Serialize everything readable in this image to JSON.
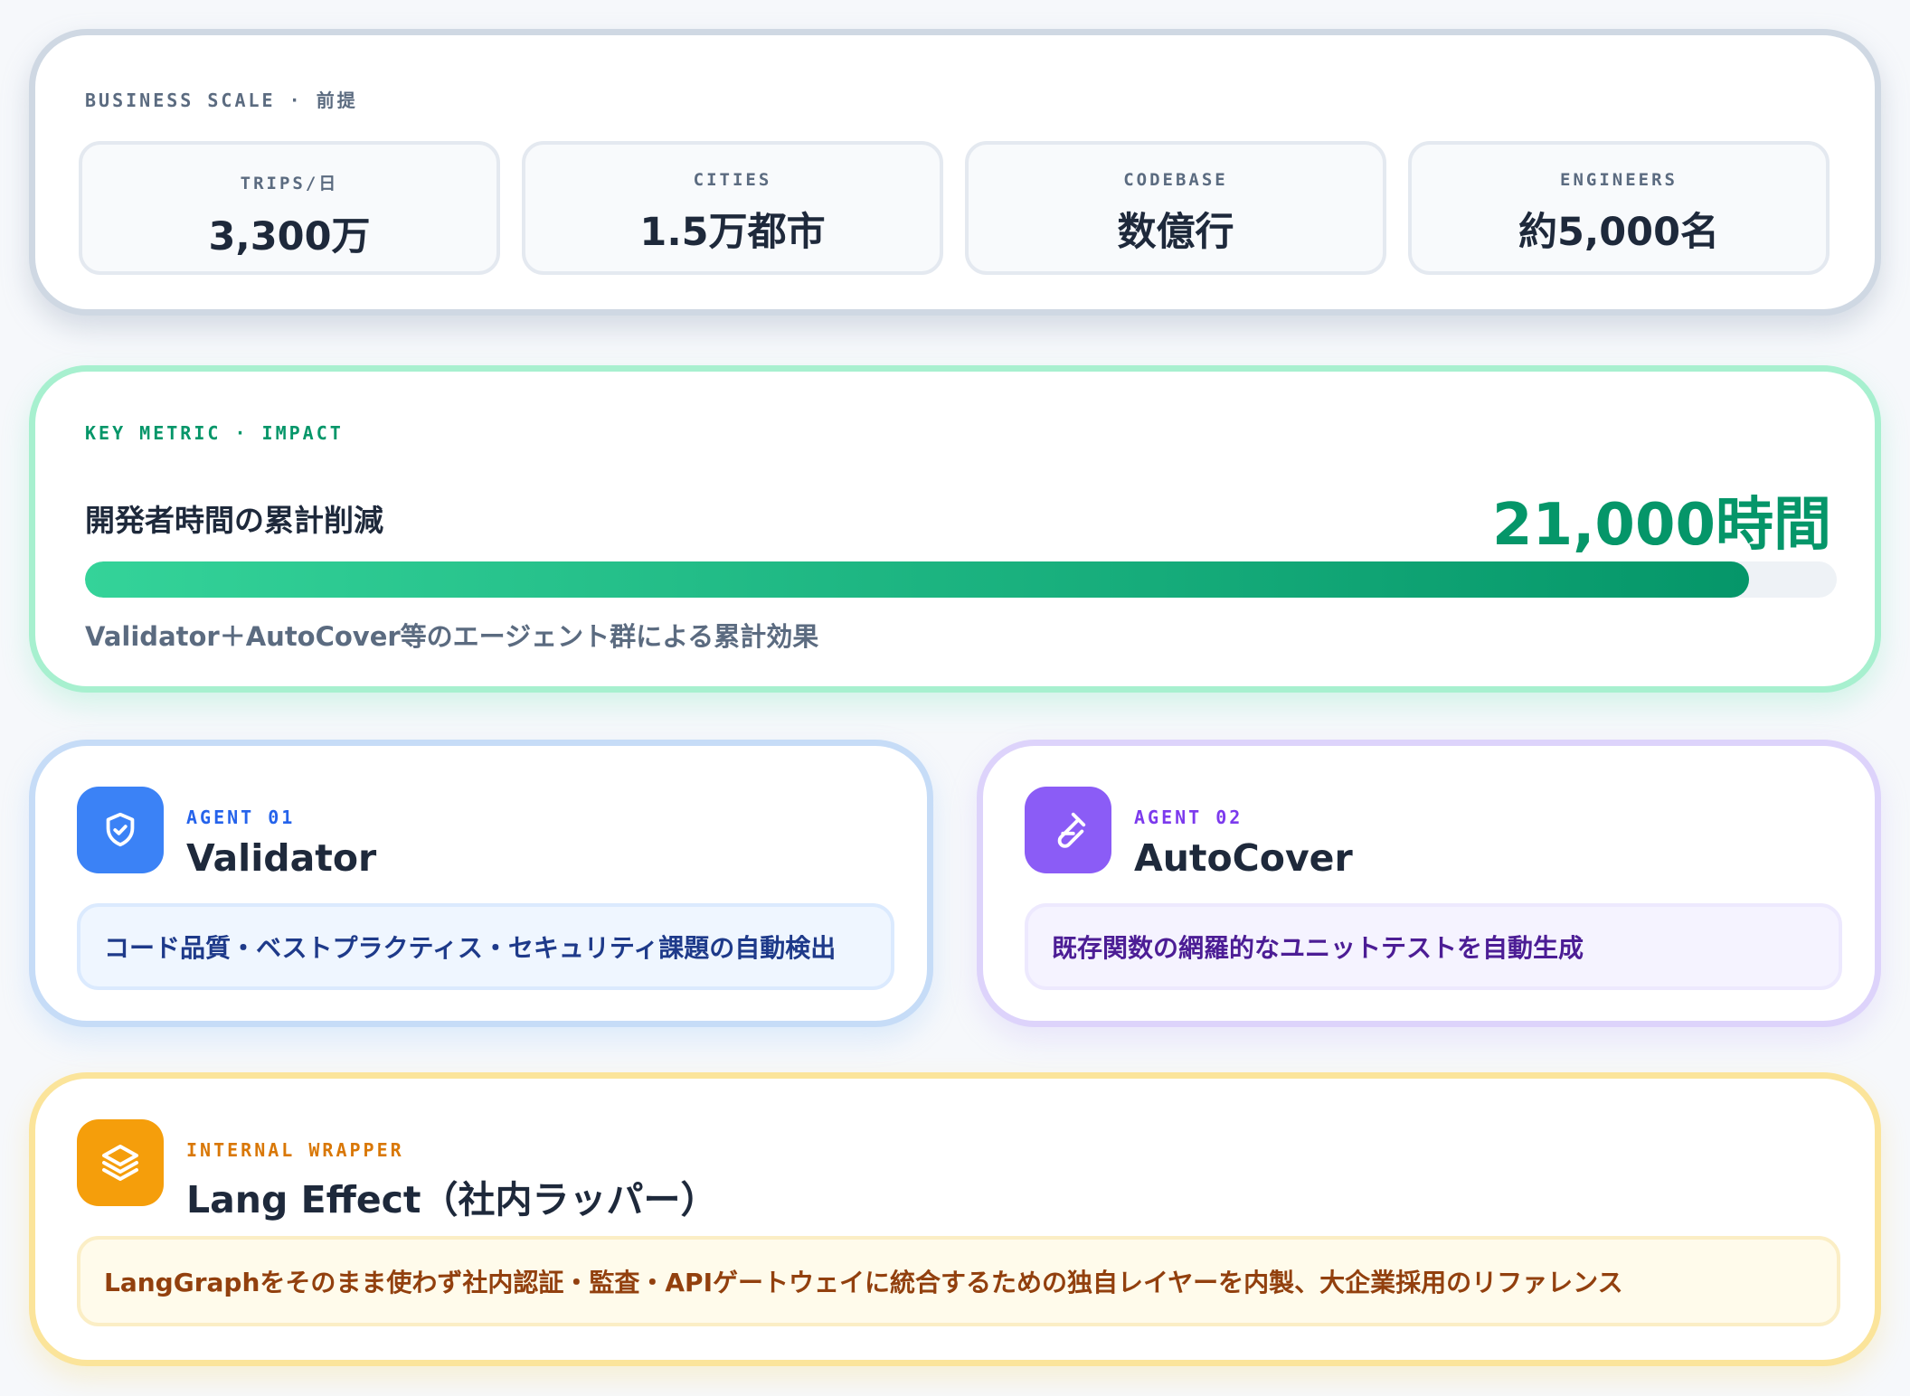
{
  "business_scale": {
    "label": "BUSINESS SCALE · 前提",
    "stats": [
      {
        "key": "TRIPS/日",
        "value": "3,300万"
      },
      {
        "key": "CITIES",
        "value": "1.5万都市"
      },
      {
        "key": "CODEBASE",
        "value": "数億行"
      },
      {
        "key": "ENGINEERS",
        "value": "約5,000名"
      }
    ]
  },
  "key_metric": {
    "label": "KEY METRIC · IMPACT",
    "title": "開発者時間の累計削減",
    "value": "21,000時間",
    "progress_fraction": 0.95,
    "description": "Validator＋AutoCover等のエージェント群による累計効果"
  },
  "agents": [
    {
      "tag": "AGENT 01",
      "name": "Validator",
      "icon": "shield-check-icon",
      "description": "コード品質・ベストプラクティス・セキュリティ課題の自動検出",
      "accent": "#3b82f6",
      "tag_color": "#2563eb",
      "box_bg": "#eff6ff",
      "box_border": "#dbeafe",
      "text_color": "#1e3a8a"
    },
    {
      "tag": "AGENT 02",
      "name": "AutoCover",
      "icon": "test-tube-icon",
      "description": "既存関数の網羅的なユニットテストを自動生成",
      "accent": "#8b5cf6",
      "tag_color": "#7c3aed",
      "box_bg": "#f5f3ff",
      "box_border": "#ede9fe",
      "text_color": "#4c1d95"
    }
  ],
  "wrapper": {
    "tag": "INTERNAL WRAPPER",
    "name": "Lang Effect（社内ラッパー）",
    "icon": "layers-icon",
    "description": "LangGraphをそのまま使わず社内認証・監査・APIゲートウェイに統合するための独自レイヤーを内製、大企業採用のリファレンス",
    "accent": "#f59e0b"
  }
}
